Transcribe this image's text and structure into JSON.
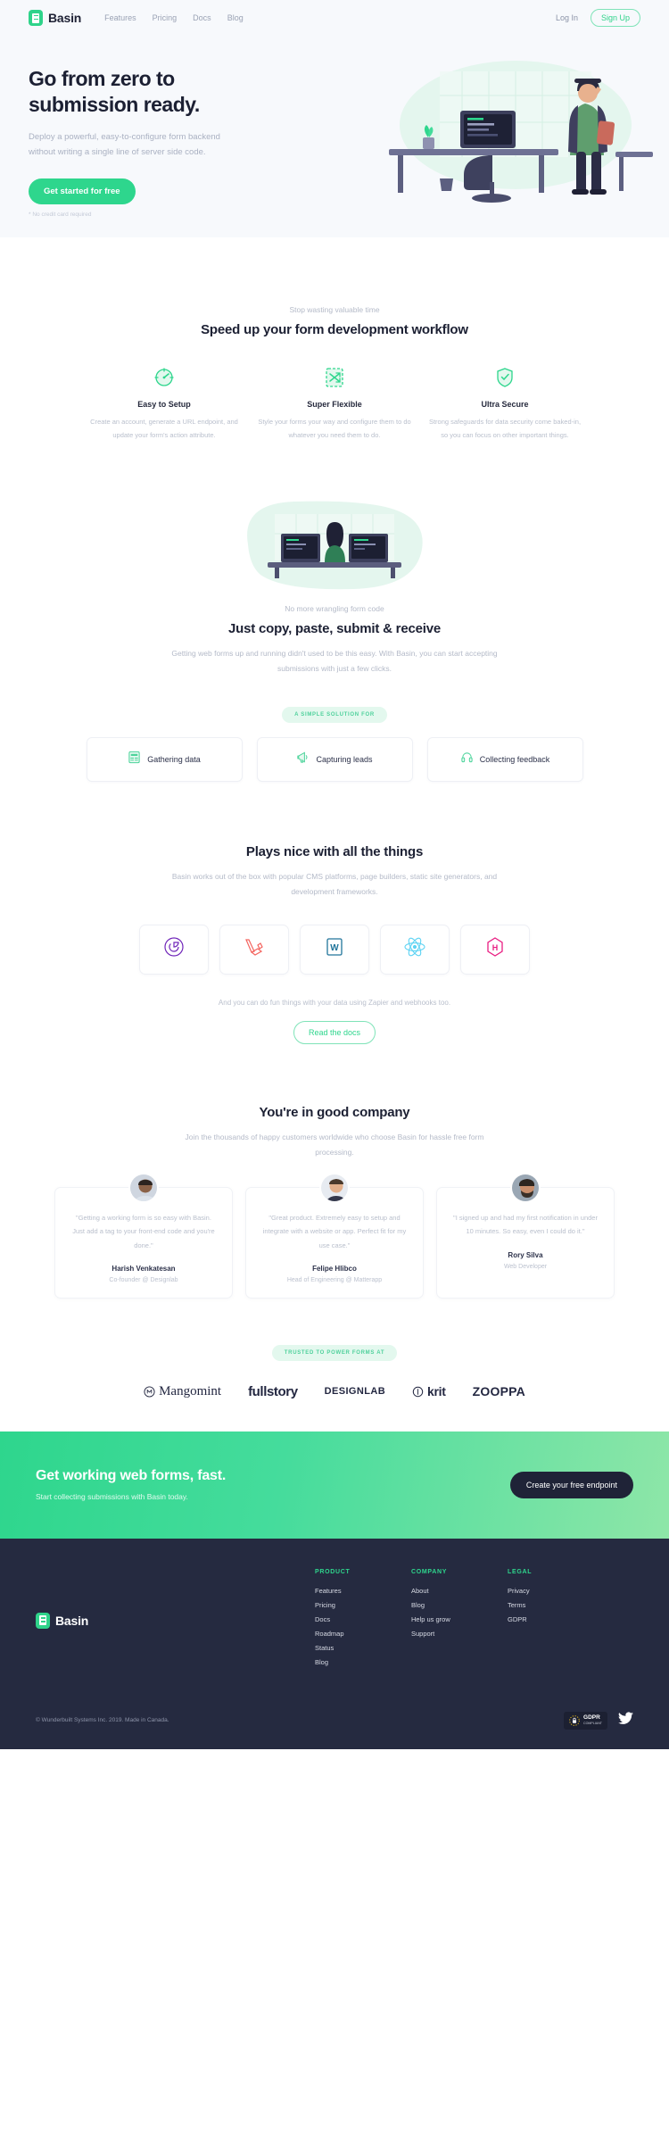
{
  "header": {
    "brand": "Basin",
    "nav": [
      {
        "label": "Features"
      },
      {
        "label": "Pricing"
      },
      {
        "label": "Docs"
      },
      {
        "label": "Blog"
      }
    ],
    "login": "Log In",
    "signup": "Sign Up"
  },
  "hero": {
    "title_line1": "Go from zero to",
    "title_line2": "submission ready.",
    "subtitle": "Deploy a powerful, easy-to-configure form backend without writing a single line of server side code.",
    "cta": "Get started for free",
    "note": "* No credit card required"
  },
  "features_section": {
    "eyebrow": "Stop wasting valuable time",
    "title": "Speed up your form development workflow",
    "items": [
      {
        "icon": "gauge-icon",
        "title": "Easy to Setup",
        "text": "Create an account, generate a URL endpoint, and update your form's action attribute."
      },
      {
        "icon": "shuffle-icon",
        "title": "Super Flexible",
        "text": "Style your forms your way and configure them to do whatever you need them to do."
      },
      {
        "icon": "shield-check-icon",
        "title": "Ultra Secure",
        "text": "Strong safeguards for data security come baked-in, so you can focus on other important things."
      }
    ]
  },
  "copy_section": {
    "eyebrow": "No more wrangling form code",
    "title": "Just copy, paste, submit & receive",
    "lead": "Getting web forms up and running didn't used to be this easy. With Basin, you can start accepting submissions with just a few clicks.",
    "badge": "A SIMPLE SOLUTION FOR",
    "usecases": [
      {
        "icon": "form-data-icon",
        "label": "Gathering data"
      },
      {
        "icon": "megaphone-icon",
        "label": "Capturing leads"
      },
      {
        "icon": "headset-icon",
        "label": "Collecting feedback"
      }
    ]
  },
  "integrations_section": {
    "title": "Plays nice with all the things",
    "lead": "Basin works out of the box with popular CMS platforms, page builders, static site generators, and development frameworks.",
    "logos": [
      {
        "name": "gatsby-logo",
        "color": "#7026b9"
      },
      {
        "name": "laravel-logo",
        "color": "#f4645f"
      },
      {
        "name": "wordpress-logo",
        "color": "#21759b"
      },
      {
        "name": "react-logo",
        "color": "#5ed3f3"
      },
      {
        "name": "hugo-logo",
        "color": "#e91e82"
      }
    ],
    "note": "And you can do fun things with your data using Zapier and webhooks too.",
    "cta": "Read the docs"
  },
  "testimonials_section": {
    "title": "You're in good company",
    "lead": "Join the thousands of happy customers worldwide who choose Basin for hassle free form processing.",
    "items": [
      {
        "quote": "\"Getting a working form is so easy with Basin. Just add a tag to your front-end code and you're done.\"",
        "name": "Harish Venkatesan",
        "role": "Co-founder @ Designlab"
      },
      {
        "quote": "\"Great product. Extremely easy to setup and integrate with a website or app. Perfect fit for my use case.\"",
        "name": "Felipe Hlibco",
        "role": "Head of Engineering @ Matterapp"
      },
      {
        "quote": "\"I signed up and had my first notification in under 10 minutes. So easy, even I could do it.\"",
        "name": "Rory Silva",
        "role": "Web Developer"
      }
    ]
  },
  "trusted_section": {
    "badge": "TRUSTED TO POWER FORMS AT",
    "customers": [
      {
        "name": "Mangomint"
      },
      {
        "name": "fullstory"
      },
      {
        "name": "DESIGNLAB"
      },
      {
        "name": "krit"
      },
      {
        "name": "ZOOPPA"
      }
    ]
  },
  "cta_band": {
    "title": "Get working web forms, fast.",
    "subtitle": "Start collecting submissions with Basin today.",
    "button": "Create your free endpoint"
  },
  "footer": {
    "brand": "Basin",
    "columns": [
      {
        "heading": "PRODUCT",
        "links": [
          {
            "label": "Features"
          },
          {
            "label": "Pricing"
          },
          {
            "label": "Docs"
          },
          {
            "label": "Roadmap"
          },
          {
            "label": "Status"
          },
          {
            "label": "Blog"
          }
        ]
      },
      {
        "heading": "COMPANY",
        "links": [
          {
            "label": "About"
          },
          {
            "label": "Blog"
          },
          {
            "label": "Help us grow"
          },
          {
            "label": "Support"
          }
        ]
      },
      {
        "heading": "LEGAL",
        "links": [
          {
            "label": "Privacy"
          },
          {
            "label": "Terms"
          },
          {
            "label": "GDPR"
          }
        ]
      }
    ],
    "copyright": "© Wunderbuilt Systems Inc. 2019. Made in Canada.",
    "gdpr_line1": "GDPR",
    "gdpr_line2": "COMPLIANT",
    "social": "twitter-icon"
  },
  "colors": {
    "accent": "#2ed68d",
    "dark": "#252a40",
    "muted": "#b4bac8"
  }
}
